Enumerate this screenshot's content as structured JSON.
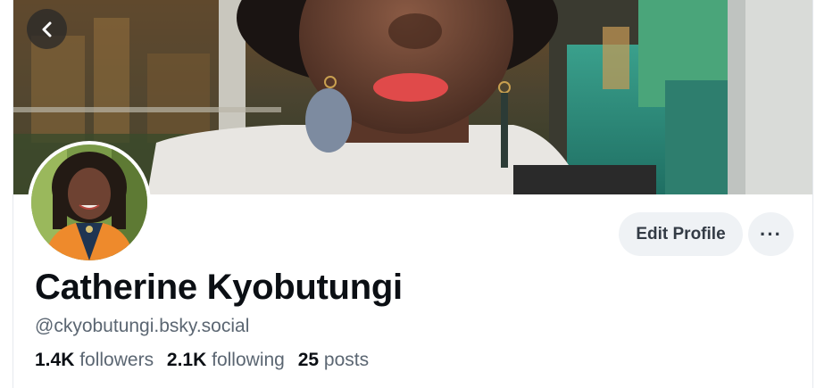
{
  "profile": {
    "display_name": "Catherine Kyobutungi",
    "handle": "@ckyobutungi.bsky.social",
    "stats": {
      "followers_count": "1.4K",
      "followers_label": "followers",
      "following_count": "2.1K",
      "following_label": "following",
      "posts_count": "25",
      "posts_label": "posts"
    }
  },
  "actions": {
    "edit_profile_label": "Edit Profile",
    "more_label": "···"
  },
  "icons": {
    "back": "chevron-left-icon"
  },
  "colors": {
    "button_bg": "#eff2f5",
    "text_primary": "#0b0f14",
    "text_secondary": "#5b6672"
  }
}
